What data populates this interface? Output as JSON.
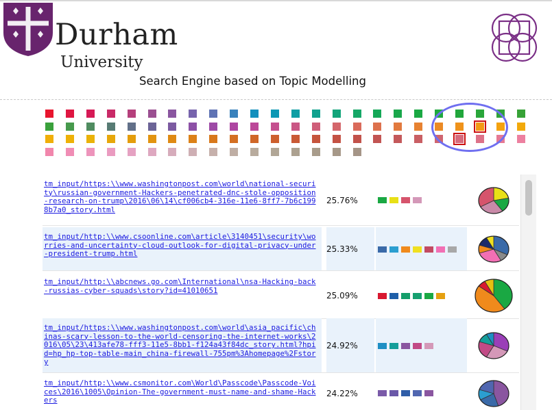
{
  "header": {
    "university_name": "Durham",
    "university_sub": "University",
    "title": "Search Engine based on Topic Modelling",
    "brand_color": "#68246d"
  },
  "topic_palette": {
    "rows": [
      [
        "#e8152e",
        "#df1641",
        "#d61a56",
        "#c92a67",
        "#b5407c",
        "#9b4f91",
        "#8a56a0",
        "#7764ac",
        "#5f73b4",
        "#3a82bc",
        "#138fbd",
        "#0d98b4",
        "#0f9ea4",
        "#10a18e",
        "#12a47a",
        "#15a767",
        "#14a857",
        "#19a74b",
        "#1aa843",
        "#1ea83f",
        "#21a63c",
        "#2aa63a",
        "#2fa339",
        "#37a237"
      ],
      [
        "#3aa13c",
        "#479a4d",
        "#508c60",
        "#577b74",
        "#627089",
        "#6c6497",
        "#7c5aa1",
        "#8d51a6",
        "#9e4aa6",
        "#ae46a1",
        "#bc4899",
        "#c5508f",
        "#ca5785",
        "#cf5e79",
        "#d4666b",
        "#da6b5b",
        "#dd714d",
        "#e27a3f",
        "#e78231",
        "#eb8a25",
        "#ef921b",
        "#f39a14",
        "#f4a20f",
        "#f2a90b"
      ],
      [
        "#f0ae08",
        "#eeb107",
        "#eab208",
        "#e7a70a",
        "#e49d0c",
        "#e29410",
        "#df8a14",
        "#dc8118",
        "#d8781c",
        "#d46f22",
        "#d06728",
        "#cd602e",
        "#c95a36",
        "#c6553d",
        "#c45244",
        "#c2524b",
        "#c25553",
        "#c4595b",
        "#c95f64",
        "#cf6570",
        "#d66b7c",
        "#dd7288",
        "#e67994",
        "#ed80a0"
      ],
      [
        "#f186ac",
        "#f08db5",
        "#ed94bb",
        "#ea9bc0",
        "#e5a2c2",
        "#dea8c0",
        "#d6acbb",
        "#ceafb4",
        "#c6b0ab",
        "#bfaea4",
        "#b8ab9d",
        "#b1a696",
        "#aca190",
        "#a89c8b",
        "#a69888",
        "#a59587"
      ]
    ],
    "selected": [
      [
        1,
        21
      ],
      [
        2,
        20
      ]
    ]
  },
  "results": [
    {
      "url": "tm_input/https:\\\\www.washingtonpost.com\\world\\national-security\\russian-government-Hackers-penetrated-dnc-stole-opposition-research-on-trump\\2016\\06\\14\\cf006cb4-316e-11e6-8ff7-7b6c1998b7a0_story.html",
      "score": "25.76%",
      "topic_colors": [
        "#1aa843",
        "#e8e017",
        "#d6546c",
        "#d498b8"
      ],
      "pie": [
        [
          "#e8e017",
          0.22
        ],
        [
          "#1aa843",
          0.18
        ],
        [
          "#c98aa8",
          0.27
        ],
        [
          "#d6546c",
          0.33
        ]
      ]
    },
    {
      "url": "tm_input/http:\\\\www.csoonline.com\\article\\3140451\\security\\worries-and-uncertainty-cloud-outlook-for-digital-privacy-under-president-trump.html",
      "score": "25.33%",
      "topic_colors": [
        "#3a6aa8",
        "#2b9ed0",
        "#f08a1c",
        "#f0e020",
        "#c24a62",
        "#f26fb4",
        "#a8a8a8"
      ],
      "pie": [
        [
          "#3a6aa8",
          0.32
        ],
        [
          "#8a8a8a",
          0.1
        ],
        [
          "#f26fb4",
          0.28
        ],
        [
          "#f08a1c",
          0.1
        ],
        [
          "#1a2a6b",
          0.12
        ],
        [
          "#f0e020",
          0.08
        ]
      ]
    },
    {
      "url": "tm_input/http:\\\\abcnews.go.com\\International\\nsa-Hacking-back-russias-cyber-squads\\story?id=41010651",
      "score": "25.09%",
      "topic_colors": [
        "#d81830",
        "#1f5fa8",
        "#149e6a",
        "#16a070",
        "#1aa843",
        "#e5a010"
      ],
      "pie": [
        [
          "#1aa843",
          0.4
        ],
        [
          "#f08a1c",
          0.45
        ],
        [
          "#d81830",
          0.07
        ],
        [
          "#e5c010",
          0.08
        ]
      ]
    },
    {
      "url": "tm_input/https:\\\\www.washingtonpost.com\\world\\asia_pacific\\chinas-scary-lesson-to-the-world-censoring-the-internet-works\\2016\\05\\23\\413afe78-fff3-11e5-8bb1-f124a43f84dc_story.html?hpid=hp_hp-top-table-main_china-firewall-755pm%3Ahomepage%2Fstory",
      "score": "24.92%",
      "topic_colors": [
        "#1e8fc4",
        "#149e9a",
        "#8a56a0",
        "#c24a86",
        "#d498b8"
      ],
      "pie": [
        [
          "#9a3fb8",
          0.32
        ],
        [
          "#d498b8",
          0.26
        ],
        [
          "#c24a86",
          0.22
        ],
        [
          "#149e9a",
          0.12
        ],
        [
          "#1e8fc4",
          0.08
        ]
      ]
    },
    {
      "url": "tm_input/http:\\\\www.csmonitor.com\\World\\Passcode\\Passcode-Voices\\2016\\1005\\Opinion-The-government-must-name-and-shame-Hackers",
      "score": "24.22%",
      "topic_colors": [
        "#7a5aa8",
        "#6a58a8",
        "#2f5ea8",
        "#5066b0",
        "#8a56a0"
      ],
      "pie": [
        [
          "#8a56a0",
          0.45
        ],
        [
          "#3a6aa8",
          0.22
        ],
        [
          "#2b9ed0",
          0.13
        ],
        [
          "#5066b0",
          0.2
        ]
      ]
    }
  ]
}
